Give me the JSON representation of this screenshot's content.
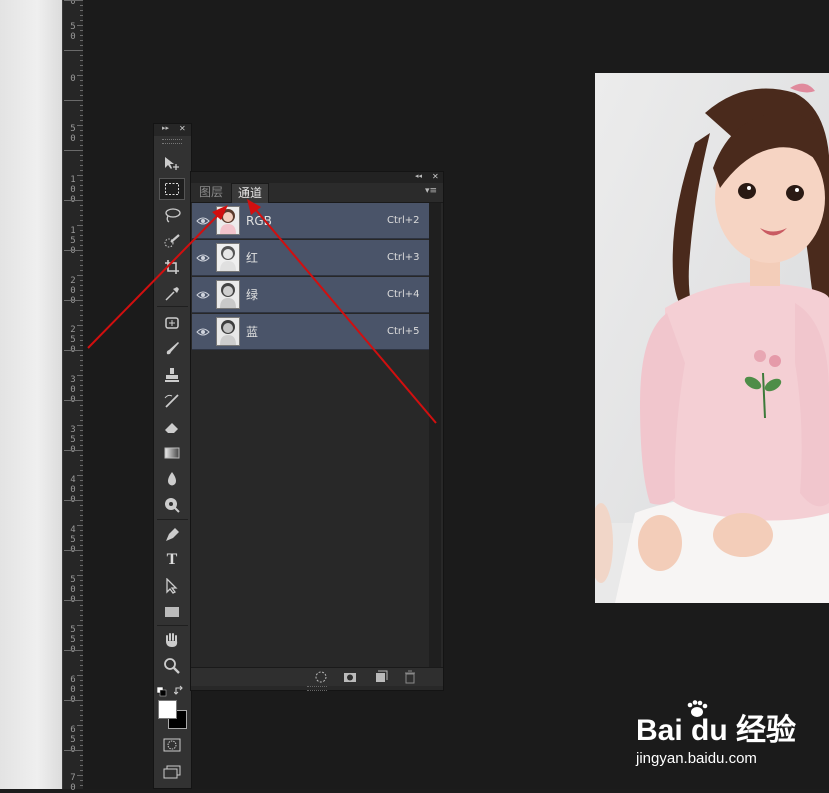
{
  "ruler": {
    "labels": [
      "0",
      "5\n0",
      "0",
      "5\n0",
      "1\n0\n0",
      "1\n5\n0",
      "2\n0\n0",
      "2\n5\n0",
      "3\n0\n0",
      "3\n5\n0",
      "4\n0\n0",
      "4\n5\n0",
      "5\n0\n0",
      "5\n5\n0",
      "6\n0\n0",
      "6\n5\n0",
      "7\n0"
    ]
  },
  "tools_panel": {
    "collapse_glyph": "▸▸",
    "close_glyph": "✕",
    "tools": [
      "move-tool",
      "rectangular-marquee-tool",
      "lasso-tool",
      "quick-selection-tool",
      "crop-tool",
      "eyedropper-tool",
      "spot-healing-brush-tool",
      "brush-tool",
      "clone-stamp-tool",
      "history-brush-tool",
      "eraser-tool",
      "gradient-tool",
      "blur-tool",
      "dodge-tool",
      "pen-tool",
      "type-tool",
      "path-selection-tool",
      "rectangle-tool",
      "hand-tool",
      "zoom-tool"
    ],
    "type_tool_glyph": "T",
    "foreground_color": "#ffffff",
    "background_color": "#000000"
  },
  "channels_panel": {
    "collapse_glyph": "◂◂",
    "close_glyph": "✕",
    "menu_glyph": "▾≡",
    "tabs": [
      {
        "label": "图层",
        "active": false
      },
      {
        "label": "通道",
        "active": true
      }
    ],
    "channels": [
      {
        "name": "RGB",
        "shortcut": "Ctrl+2"
      },
      {
        "name": "红",
        "shortcut": "Ctrl+3"
      },
      {
        "name": "绿",
        "shortcut": "Ctrl+4"
      },
      {
        "name": "蓝",
        "shortcut": "Ctrl+5"
      }
    ],
    "row_color": "#4a5469"
  },
  "annotation_color": "#d10f0f",
  "watermark": {
    "logo": "Bai du 经验",
    "url": "jingyan.baidu.com"
  }
}
